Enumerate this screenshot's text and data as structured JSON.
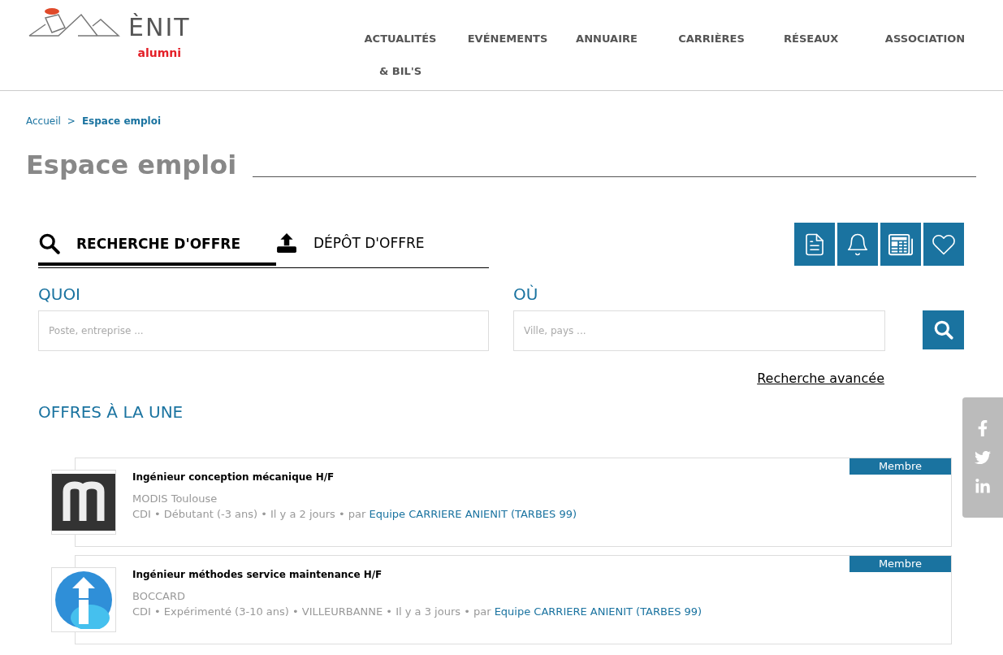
{
  "logo": {
    "wordmark": "ÈNIT",
    "subtitle": "alumni"
  },
  "nav": [
    "ACTUALITÉS & BIL'S",
    "EVÉNEMENTS",
    "ANNUAIRE",
    "CARRIÈRES",
    "RÉSEAUX",
    "ASSOCIATION"
  ],
  "breadcrumb": [
    {
      "label": "Accueil",
      "current": false
    },
    {
      "label": "Espace emploi",
      "current": true
    }
  ],
  "breadcrumb_separator": ">",
  "title": "Espace emploi",
  "tabs": [
    {
      "label": "RECHERCHE D'OFFRE",
      "kind": "search",
      "selected": true
    },
    {
      "label": "DÉPÔT D'OFFRE",
      "kind": "upload",
      "selected": false
    }
  ],
  "search": {
    "what_label": "QUOI",
    "what_placeholder": "Poste, entreprise ...",
    "where_label": "OÙ",
    "where_placeholder": "Ville, pays ...",
    "advanced_link": "Recherche avancée"
  },
  "section_title": "OFFRES À LA UNE",
  "offers": [
    {
      "title": "Ingénieur conception mécanique H/F",
      "company": "MODIS Toulouse",
      "meta": "CDI • Débutant (-3 ans) • Il y a 2 jours • par",
      "author": "Equipe CARRIERE ANIENIT (TARBES 99)",
      "badge": "Membre"
    },
    {
      "title": "Ingénieur méthodes service maintenance H/F",
      "company": "BOCCARD",
      "meta": "CDI • Expérimenté (3-10 ans) • VILLEURBANNE • Il y a 3 jours • par",
      "author": "Equipe CARRIERE ANIENIT (TARBES 99)",
      "badge": "Membre"
    }
  ]
}
